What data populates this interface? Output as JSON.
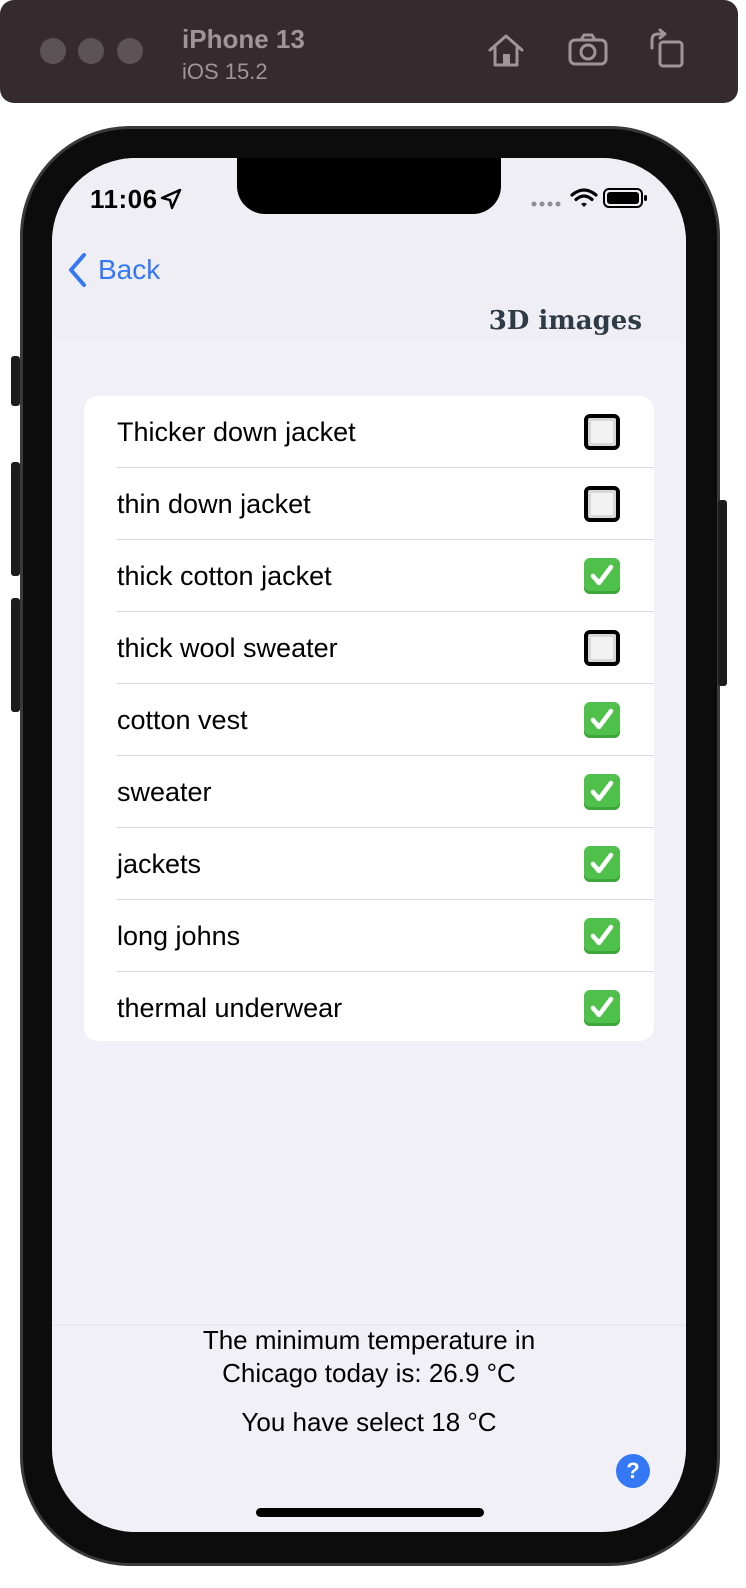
{
  "simulator": {
    "device_name": "iPhone 13",
    "os_version": "iOS 15.2",
    "toolbar_icons": [
      "home-icon",
      "screenshot-camera-icon",
      "rotate-icon"
    ]
  },
  "status_bar": {
    "time": "11:06",
    "icons": [
      "location-arrow-icon",
      "cellular-dots-icon",
      "wifi-icon",
      "battery-icon"
    ]
  },
  "nav": {
    "back_label": "Back",
    "title": "3D images"
  },
  "clothing_list": {
    "items": [
      {
        "label": "Thicker down jacket",
        "checked": false
      },
      {
        "label": "thin down jacket",
        "checked": false
      },
      {
        "label": "thick cotton jacket",
        "checked": true
      },
      {
        "label": "thick wool sweater",
        "checked": false
      },
      {
        "label": "cotton vest",
        "checked": true
      },
      {
        "label": "sweater",
        "checked": true
      },
      {
        "label": "jackets",
        "checked": true
      },
      {
        "label": "long johns",
        "checked": true
      },
      {
        "label": "thermal underwear",
        "checked": true
      }
    ]
  },
  "footer": {
    "temp_line1": "The minimum temperature in",
    "temp_line2": "Chicago today is: 26.9 °C",
    "selected_line": "You have select 18 °C",
    "help_label": "?"
  },
  "colors": {
    "accent": "#3478f6",
    "check_green": "#4fc14a",
    "background": "#f1f0f6"
  }
}
